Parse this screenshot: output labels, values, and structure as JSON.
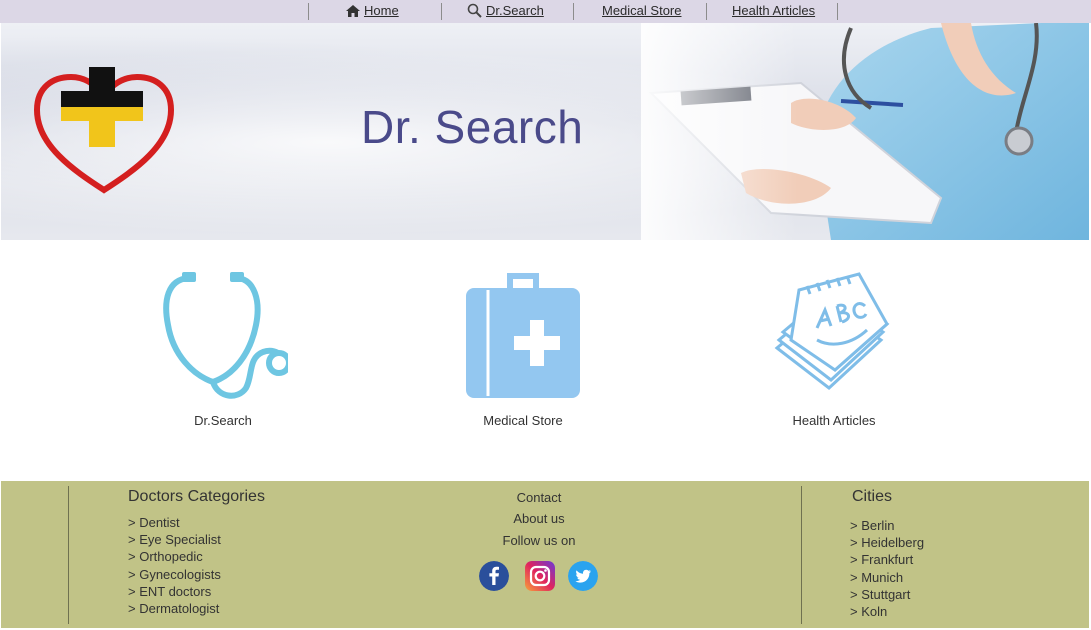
{
  "nav": {
    "items": [
      {
        "label": "Home",
        "icon": "home-icon"
      },
      {
        "label": "Dr.Search",
        "icon": "search-icon"
      },
      {
        "label": "Medical Store"
      },
      {
        "label": "Health Articles"
      }
    ]
  },
  "banner": {
    "title": "Dr. Search"
  },
  "features": [
    {
      "label": "Dr.Search",
      "icon": "stethoscope-icon"
    },
    {
      "label": "Medical Store",
      "icon": "medical-kit-icon"
    },
    {
      "label": "Health Articles",
      "icon": "notepad-icon"
    }
  ],
  "footer": {
    "categories_title": "Doctors Categories",
    "categories": [
      "> Dentist",
      "> Eye Specialist",
      "> Orthopedic",
      "> Gynecologists",
      "> ENT doctors",
      "> Dermatologist"
    ],
    "contact": "Contact",
    "about": "About us",
    "follow": "Follow us on",
    "cities_title": "Cities",
    "cities": [
      "> Berlin",
      "> Heidelberg",
      "> Frankfurt",
      "> Munich",
      "> Stuttgart",
      "> Koln"
    ]
  },
  "colors": {
    "nav_bg": "#dcd7e6",
    "footer_bg": "#c1c387",
    "accent_blue": "#7ec3e6",
    "title_color": "#4a4a8a"
  }
}
